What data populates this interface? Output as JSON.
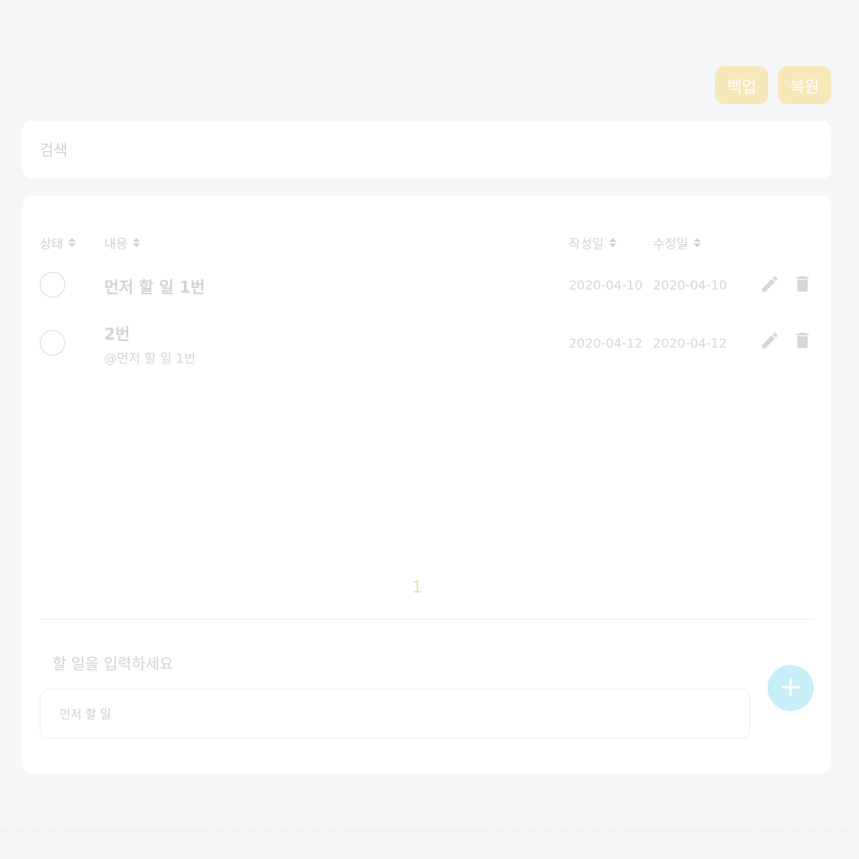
{
  "toolbar": {
    "backup_label": "백업",
    "restore_label": "복원"
  },
  "search": {
    "placeholder": "검색"
  },
  "table": {
    "headers": {
      "status": "상태",
      "content": "내용",
      "created": "작성일",
      "modified": "수정일"
    },
    "rows": [
      {
        "title": "먼저 할 일 1번",
        "reference": "",
        "created": "2020-04-10",
        "modified": "2020-04-10",
        "done": false
      },
      {
        "title": "2번",
        "reference": "@먼저 할 일 1번",
        "created": "2020-04-12",
        "modified": "2020-04-12",
        "done": false
      }
    ]
  },
  "pagination": {
    "current_page": "1"
  },
  "composer": {
    "placeholder": "할 일을 입력하세요",
    "reference_chip": "먼저 할 일",
    "add_icon": "plus-icon"
  },
  "icons": {
    "sort": "sort-icon",
    "edit": "pencil-icon",
    "delete": "trash-icon"
  },
  "colors": {
    "background": "#f5f6f8",
    "accent_yellow": "#f7e8ba",
    "accent_cyan": "#c8eef7",
    "page_number": "#f2dfa4"
  }
}
